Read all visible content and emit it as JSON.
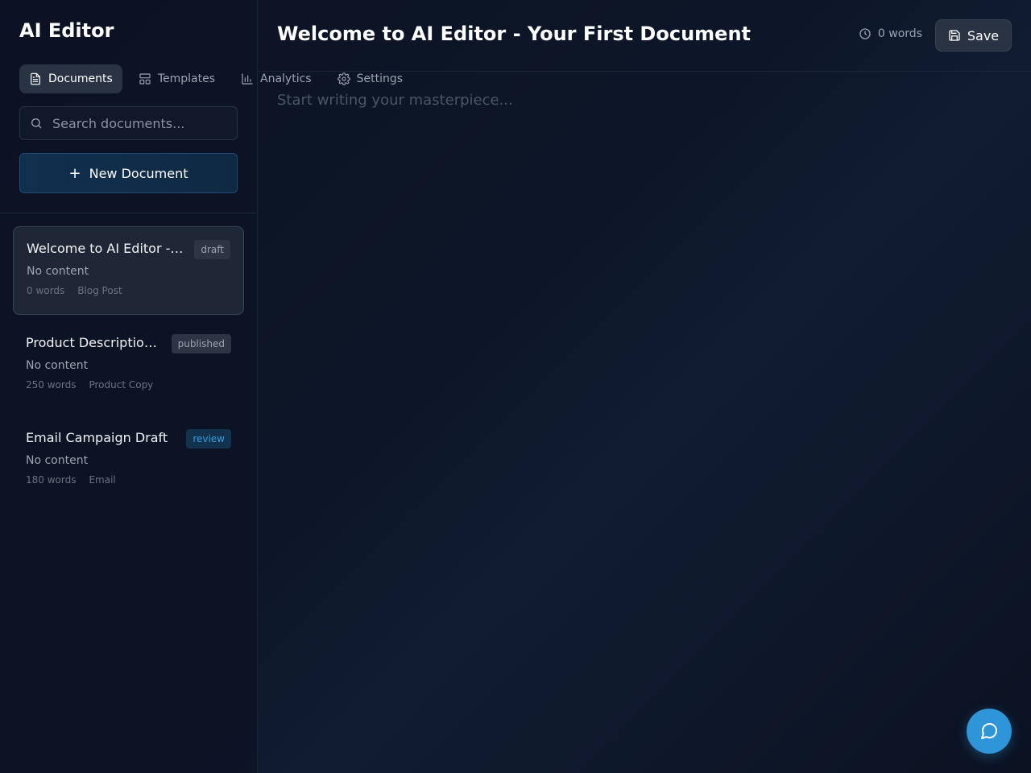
{
  "app": {
    "title": "AI Editor"
  },
  "nav": [
    {
      "label": "Documents",
      "icon": "file-icon",
      "active": true
    },
    {
      "label": "Templates",
      "icon": "layout-icon",
      "active": false
    },
    {
      "label": "Analytics",
      "icon": "bar-chart-icon",
      "active": false
    },
    {
      "label": "Settings",
      "icon": "gear-icon",
      "active": false
    }
  ],
  "search": {
    "placeholder": "Search documents...",
    "value": ""
  },
  "new_document": {
    "label": "New Document",
    "icon": "plus-icon"
  },
  "documents": [
    {
      "title": "Welcome to AI Editor - Your First Document",
      "status": "draft",
      "excerpt": "No content",
      "words": "0 words",
      "type": "Blog Post",
      "active": true
    },
    {
      "title": "Product Description Template",
      "status": "published",
      "excerpt": "No content",
      "words": "250 words",
      "type": "Product Copy",
      "active": false
    },
    {
      "title": "Email Campaign Draft",
      "status": "review",
      "excerpt": "No content",
      "words": "180 words",
      "type": "Email",
      "active": false
    }
  ],
  "editor": {
    "heading": "Welcome to AI Editor - Your First Document",
    "word_count": "0 words",
    "save_label": "Save",
    "placeholder": "Start writing your masterpiece...",
    "content": ""
  },
  "chat_button": {
    "icon": "message-circle-icon"
  },
  "colors": {
    "accent": "#2d95d8",
    "background": "#0b1120",
    "review_badge": "#3b9be0"
  }
}
